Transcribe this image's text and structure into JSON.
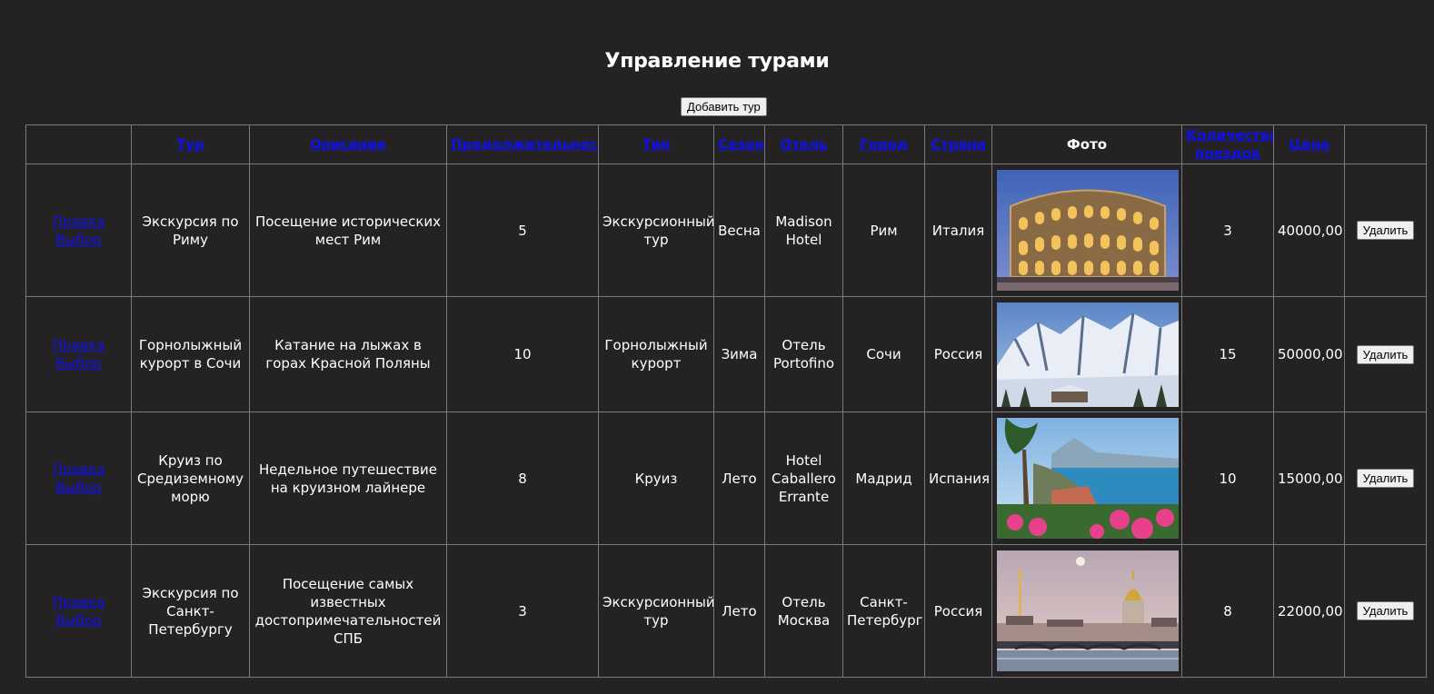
{
  "page": {
    "title": "Управление турами",
    "add_button_label": "Добавить тур"
  },
  "table": {
    "headers": {
      "tour": "Тур",
      "description": "Описание",
      "duration": "Продолжительность",
      "type": "Тип",
      "season": "Сезон",
      "hotel": "Отель",
      "city": "Город",
      "country": "Страна",
      "photo": "Фото",
      "trips": "Количество поездок",
      "price": "Цена"
    },
    "edit_link": "Правка",
    "select_link": "Выбор",
    "delete_label": "Удалить",
    "rows": [
      {
        "tour": "Экскурсия по Риму",
        "description": "Посещение исторических мест Рим",
        "duration": "5",
        "type": "Экскурсионный тур",
        "season": "Весна",
        "hotel": "Madison Hotel",
        "city": "Рим",
        "country": "Италия",
        "photo_subject": "colosseum-photo",
        "trips": "3",
        "price": "40000,00"
      },
      {
        "tour": "Горнолыжный курорт в Сочи",
        "description": "Катание на лыжах в горах Красной Поляны",
        "duration": "10",
        "type": "Горнолыжный курорт",
        "season": "Зима",
        "hotel": "Отель Portofino",
        "city": "Сочи",
        "country": "Россия",
        "photo_subject": "snowy-mountains-photo",
        "trips": "15",
        "price": "50000,00"
      },
      {
        "tour": "Круиз по Средиземному морю",
        "description": "Недельное путешествие на круизном лайнере",
        "duration": "8",
        "type": "Круиз",
        "season": "Лето",
        "hotel": "Hotel Caballero Errante",
        "city": "Мадрид",
        "country": "Испания",
        "photo_subject": "mediterranean-coast-photo",
        "trips": "10",
        "price": "15000,00"
      },
      {
        "tour": "Экскурсия по Санкт-Петербургу",
        "description": "Посещение самых известных достопримечательностей СПБ",
        "duration": "3",
        "type": "Экскурсионный тур",
        "season": "Лето",
        "hotel": "Отель Москва",
        "city": "Санкт-Петербург",
        "country": "Россия",
        "photo_subject": "saint-petersburg-photo",
        "trips": "8",
        "price": "22000,00"
      }
    ]
  }
}
